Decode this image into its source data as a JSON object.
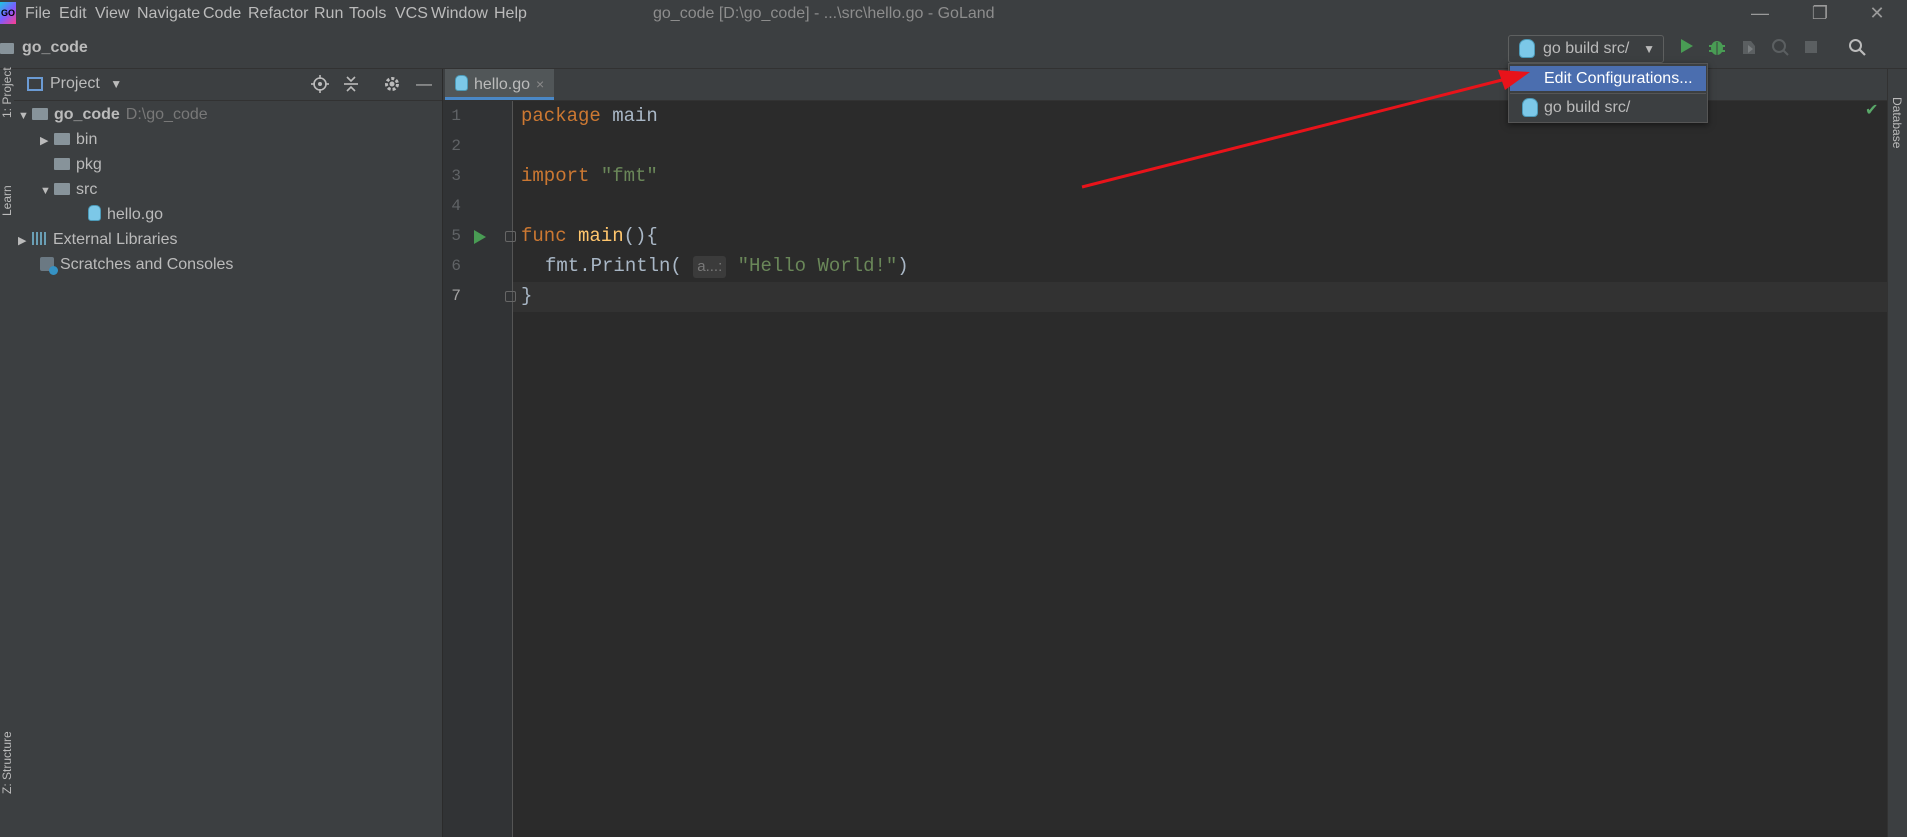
{
  "menu": {
    "items": [
      "File",
      "Edit",
      "View",
      "Navigate",
      "Code",
      "Refactor",
      "Run",
      "Tools",
      "VCS",
      "Window",
      "Help"
    ],
    "window_title": "go_code [D:\\go_code] - ...\\src\\hello.go - GoLand"
  },
  "window_controls": {
    "minimize": "—",
    "restore": "❐",
    "close": "✕"
  },
  "navbar": {
    "title": "go_code",
    "run_config": "go build src/",
    "run_config_caret": "▼",
    "icons": [
      "run-icon",
      "debug-icon",
      "coverage-icon",
      "profile-icon",
      "stop-icon",
      "search-icon"
    ],
    "accent_run": "#499c54"
  },
  "left_tabs": {
    "project": "1: Project",
    "learn": "Learn",
    "structure": "Z: Structure"
  },
  "project_panel": {
    "title": "Project",
    "caret": "▼",
    "tree": [
      {
        "label": "go_code",
        "path": "D:\\go_code",
        "expanded": true
      },
      {
        "label": "bin"
      },
      {
        "label": "pkg"
      },
      {
        "label": "src",
        "expanded": true
      },
      {
        "label": "hello.go"
      },
      {
        "label": "External Libraries"
      },
      {
        "label": "Scratches and Consoles"
      }
    ]
  },
  "editor": {
    "tab_label": "hello.go",
    "tab_close": "×",
    "line_numbers": [
      "1",
      "2",
      "3",
      "4",
      "5",
      "6",
      "7"
    ],
    "code": {
      "line1_kw": "package",
      "line1_rest": " main",
      "line3_kw": "import",
      "line3_str": "\"fmt\"",
      "line5_kw": "func",
      "line5_fn": "main",
      "line5_rest": "(){",
      "line6_pre": "fmt.Println(",
      "line6_hint": "a...:",
      "line6_str": "\"Hello World!\"",
      "line6_post": ")",
      "line7": "}"
    }
  },
  "right_tabs": {
    "database": "Database"
  },
  "dropdown": {
    "edit_configurations": "Edit Configurations...",
    "go_build": "go build src/",
    "highlight_color": "#4b6eaf"
  },
  "annotation": {
    "arrow_color": "#e8131a"
  }
}
